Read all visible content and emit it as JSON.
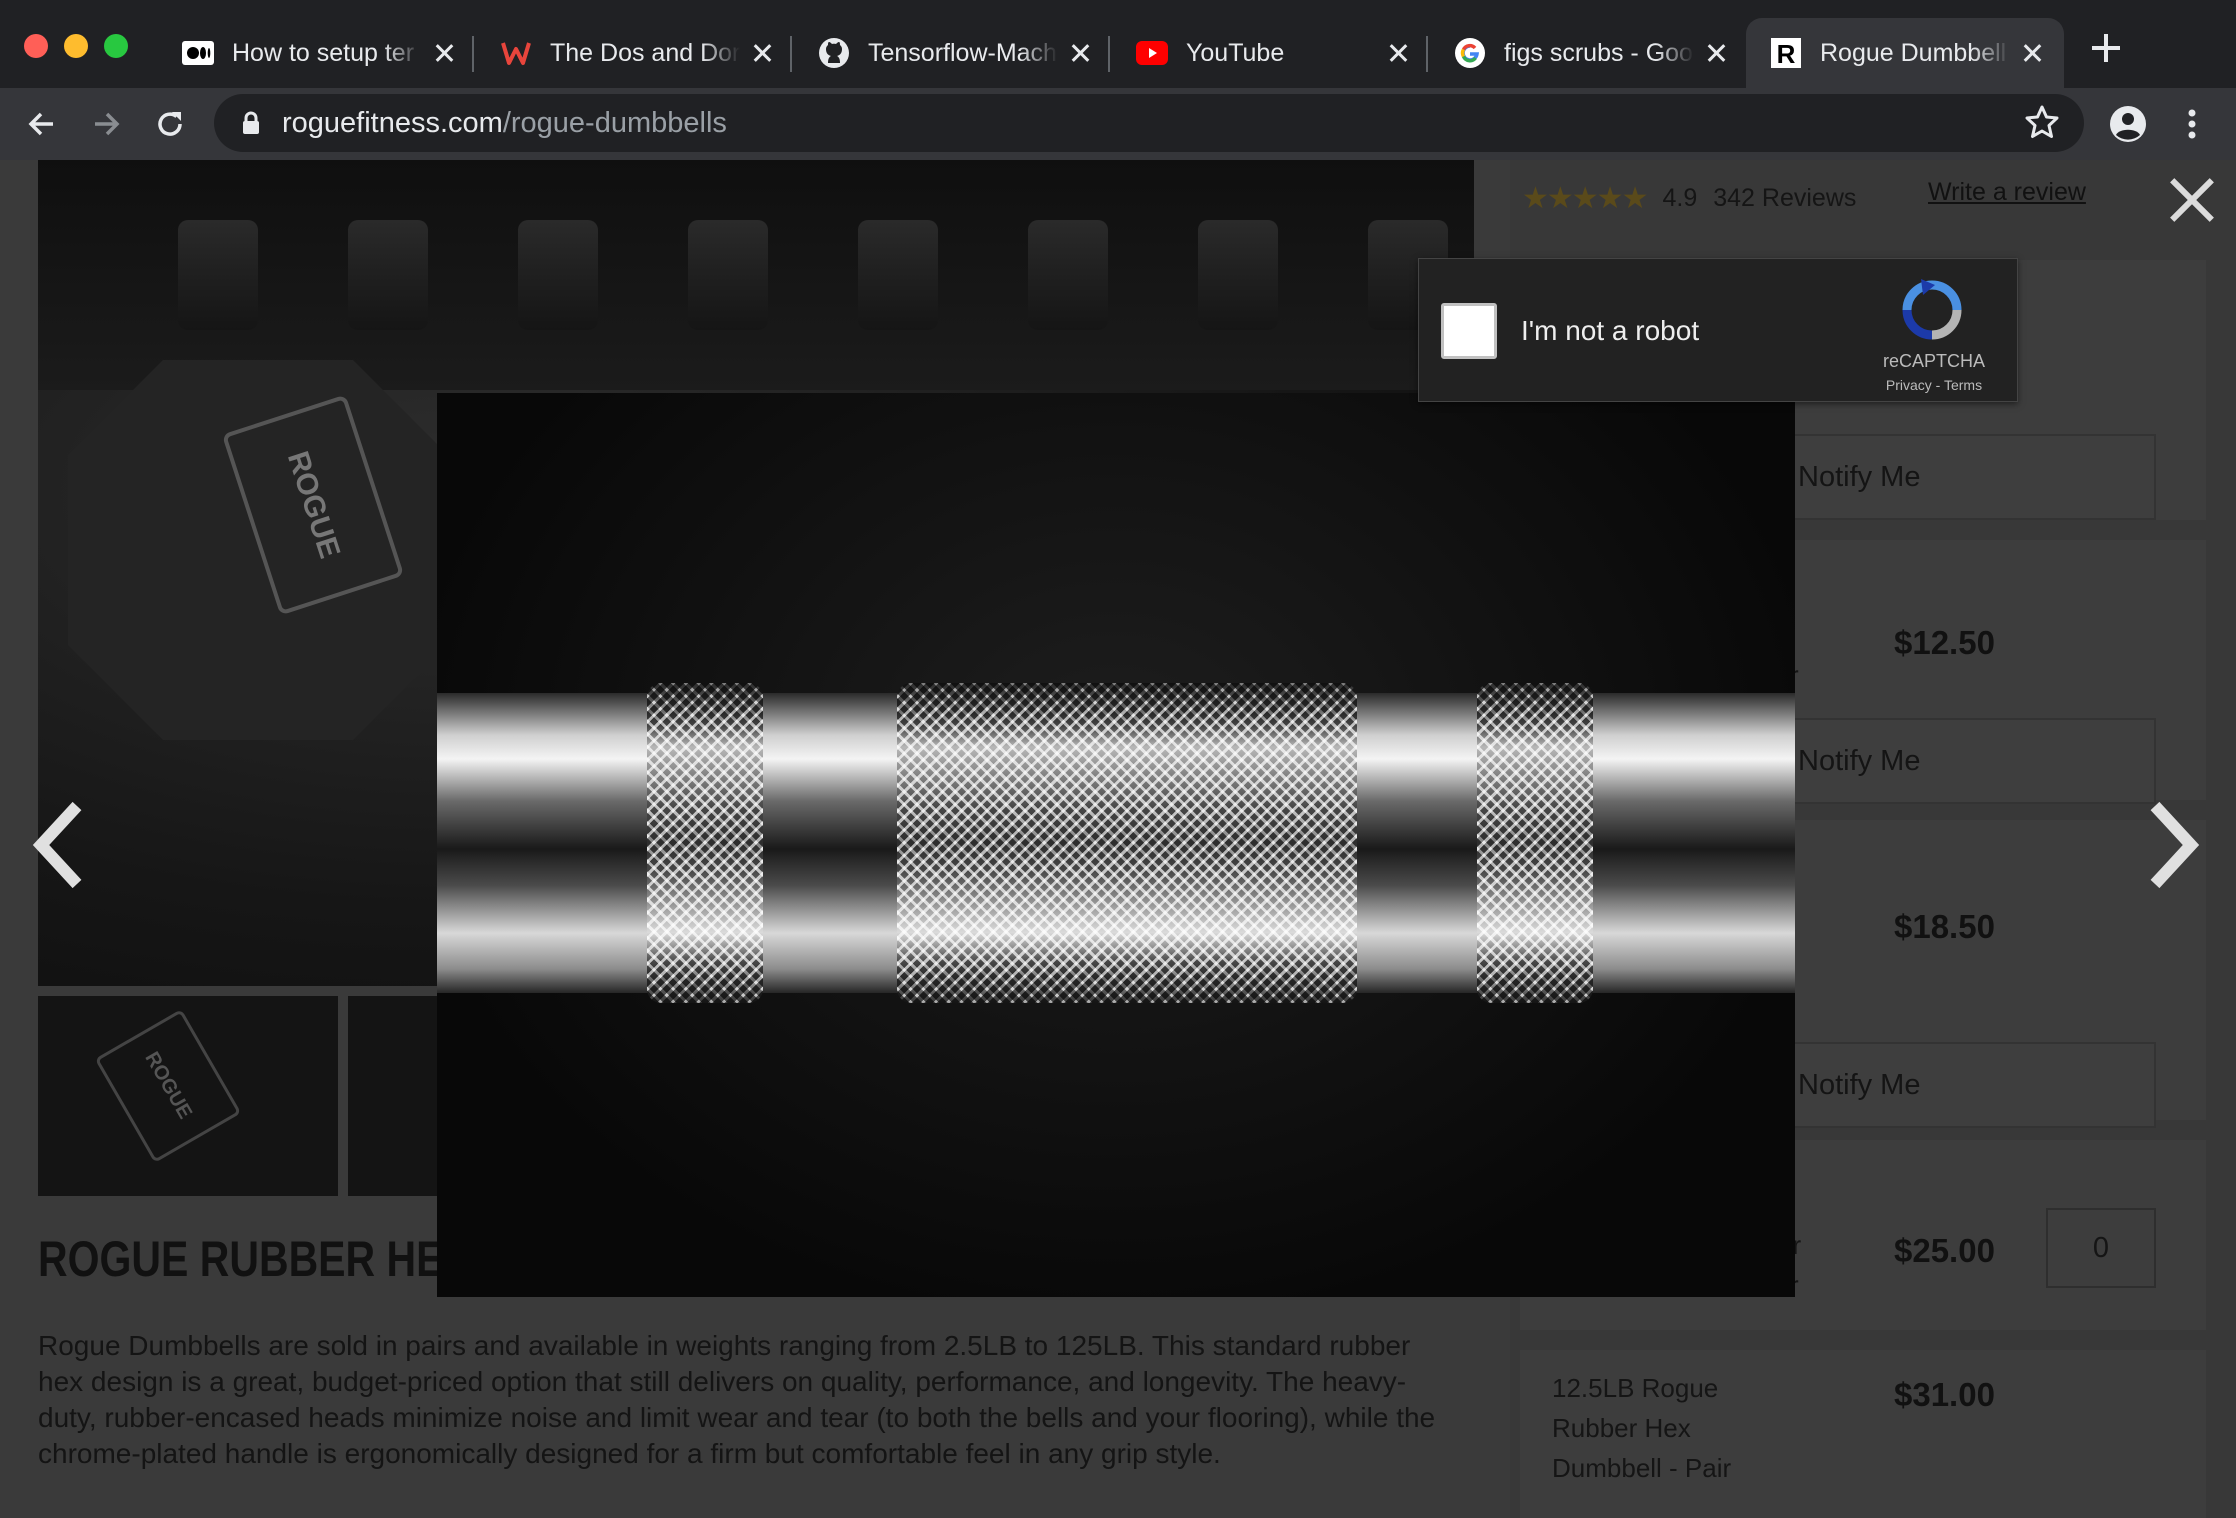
{
  "browser": {
    "tabs": [
      {
        "title": "How to setup ter",
        "favicon": "medium-icon",
        "active": false
      },
      {
        "title": "The Dos and Dor",
        "favicon": "w-logo-icon",
        "active": false
      },
      {
        "title": "Tensorflow-Mach",
        "favicon": "github-icon",
        "active": false
      },
      {
        "title": "YouTube",
        "favicon": "youtube-icon",
        "active": false
      },
      {
        "title": "figs scrubs - Goo",
        "favicon": "google-icon",
        "active": false
      },
      {
        "title": "Rogue Dumbbell",
        "favicon": "rogue-r-icon",
        "active": true
      }
    ],
    "url_domain": "roguefitness.com",
    "url_path": "/rogue-dumbbells"
  },
  "product": {
    "title": "ROGUE RUBBER HE",
    "description": "Rogue Dumbbells are sold in pairs and available in weights ranging from 2.5LB to 125LB. This standard rubber hex design is a great, budget-priced option that still delivers on quality, performance, and longevity. The heavy-duty, rubber-encased heads minimize noise and limit wear and tear (to both the bells and your flooring), while the chrome-plated handle is ergonomically designed for a firm but comfortable feel in any grip style.",
    "photo_plate_text": "ROGUE",
    "thumb_plate_text": "ROGUE"
  },
  "reviews": {
    "stars": "★★★★★",
    "rating": "4.9",
    "count": "342 Reviews",
    "write_label": "Write a review"
  },
  "variants": {
    "notify_label": "Notify Me",
    "prices": [
      "$12.50",
      "$18.50",
      "$25.00",
      "$31.00"
    ],
    "fragments": [
      "r",
      "er",
      "r"
    ],
    "qty_value": "0",
    "last_label": "12.5LB Rogue Rubber Hex Dumbbell - Pair"
  },
  "captcha": {
    "label": "I'm not a robot",
    "brand": "reCAPTCHA",
    "links": "Privacy - Terms"
  },
  "colors": {
    "overlay_bg": "#3a3a3a",
    "chrome_bg": "#202124"
  }
}
